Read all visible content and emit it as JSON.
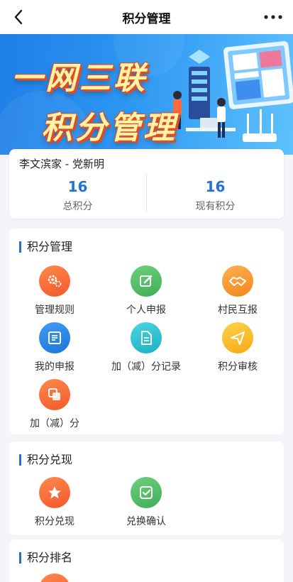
{
  "nav": {
    "title": "积分管理"
  },
  "banner": {
    "line1": "一网三联",
    "line2": "积分管理"
  },
  "info": {
    "name": "李文滨家 - 党新明",
    "total_points": {
      "value": "16",
      "label": "总积分"
    },
    "current_points": {
      "value": "16",
      "label": "现有积分"
    }
  },
  "sections": {
    "management": {
      "title": "积分管理",
      "items": [
        {
          "label": "管理规则",
          "icon": "gears-icon"
        },
        {
          "label": "个人申报",
          "icon": "edit-icon"
        },
        {
          "label": "村民互报",
          "icon": "handshake-icon"
        },
        {
          "label": "我的申报",
          "icon": "document-list-icon"
        },
        {
          "label": "加（减）分记录",
          "icon": "file-icon"
        },
        {
          "label": "积分审核",
          "icon": "paper-plane-icon"
        },
        {
          "label": "加（减）分",
          "icon": "copy-icon"
        }
      ]
    },
    "redeem": {
      "title": "积分兑现",
      "items": [
        {
          "label": "积分兑现",
          "icon": "star-icon"
        },
        {
          "label": "兑换确认",
          "icon": "check-icon"
        }
      ]
    },
    "ranking": {
      "title": "积分排名"
    }
  },
  "colors": {
    "accent": "#1f73d6",
    "page_bg": "#f3f5f8"
  }
}
